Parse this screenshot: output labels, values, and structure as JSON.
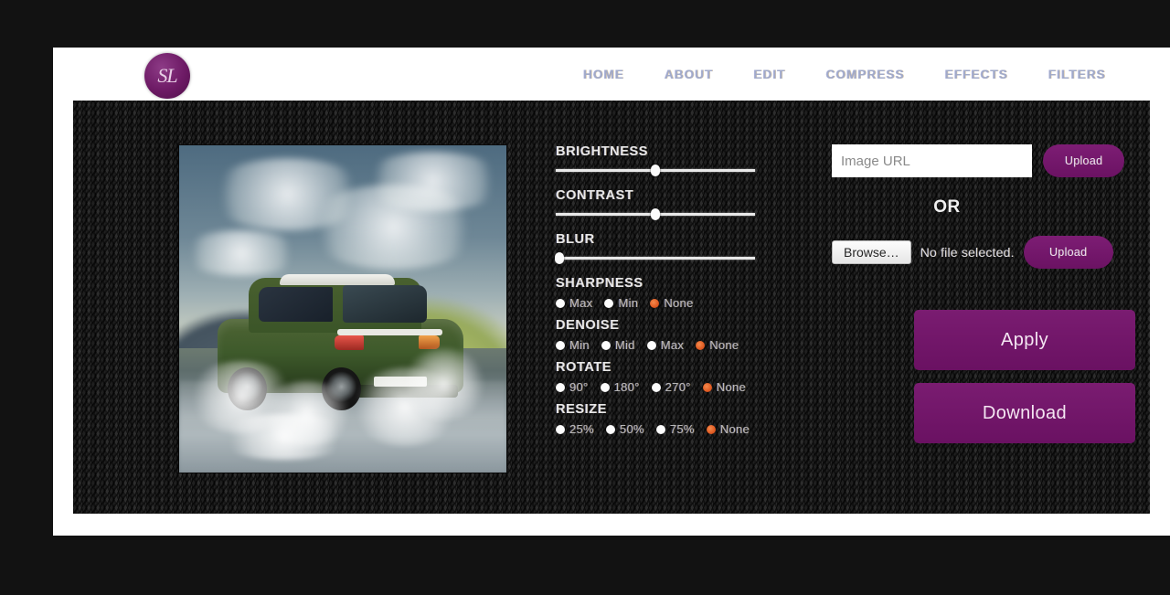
{
  "brand": {
    "logo_text": "SL",
    "logo_color": "#6d1a65"
  },
  "nav": {
    "items": [
      {
        "label": "HOME"
      },
      {
        "label": "ABOUT"
      },
      {
        "label": "EDIT"
      },
      {
        "label": "COMPRESS"
      },
      {
        "label": "EFFECTS"
      },
      {
        "label": "FILTERS"
      }
    ]
  },
  "preview": {
    "alt": "green suv driving through water with mountains and cloudy sky"
  },
  "controls": {
    "sliders": [
      {
        "label": "BRIGHTNESS",
        "value": 50
      },
      {
        "label": "CONTRAST",
        "value": 50
      },
      {
        "label": "BLUR",
        "value": 0
      }
    ],
    "radios": [
      {
        "label": "SHARPNESS",
        "options": [
          {
            "label": "Max",
            "selected": false
          },
          {
            "label": "Min",
            "selected": false
          },
          {
            "label": "None",
            "selected": true
          }
        ]
      },
      {
        "label": "DENOISE",
        "options": [
          {
            "label": "Min",
            "selected": false
          },
          {
            "label": "Mid",
            "selected": false
          },
          {
            "label": "Max",
            "selected": false
          },
          {
            "label": "None",
            "selected": true
          }
        ]
      },
      {
        "label": "ROTATE",
        "options": [
          {
            "label": "90°",
            "selected": false
          },
          {
            "label": "180°",
            "selected": false
          },
          {
            "label": "270°",
            "selected": false
          },
          {
            "label": "None",
            "selected": true
          }
        ]
      },
      {
        "label": "RESIZE",
        "options": [
          {
            "label": "25%",
            "selected": false
          },
          {
            "label": "50%",
            "selected": false
          },
          {
            "label": "75%",
            "selected": false
          },
          {
            "label": "None",
            "selected": true
          }
        ]
      }
    ]
  },
  "upload": {
    "url_placeholder": "Image URL",
    "url_value": "",
    "url_upload_label": "Upload",
    "or_label": "OR",
    "browse_label": "Browse…",
    "file_status": "No file selected.",
    "file_upload_label": "Upload"
  },
  "actions": {
    "apply_label": "Apply",
    "download_label": "Download"
  },
  "colors": {
    "accent_purple": "#6b1263",
    "selected_radio": "#df5a22",
    "panel_dark": "#232323",
    "page_white": "#ffffff"
  }
}
